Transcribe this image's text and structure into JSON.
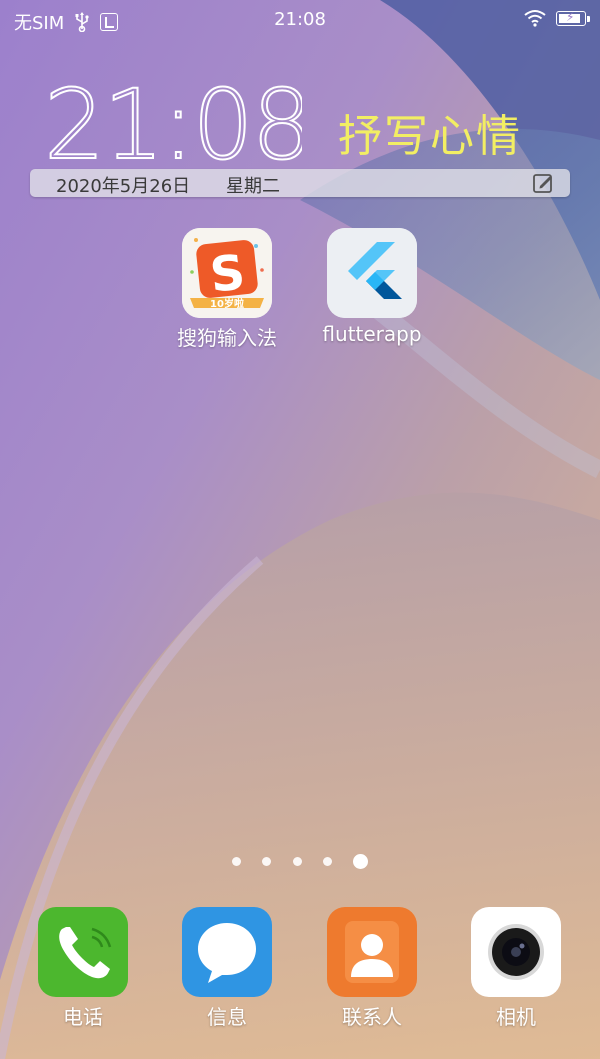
{
  "status_bar": {
    "carrier": "无SIM",
    "time": "21:08",
    "battery_level": 0.9,
    "icons": [
      "usb-icon",
      "usb-debug-icon",
      "wifi-icon",
      "battery-charging-icon"
    ]
  },
  "clock_widget": {
    "big_time": "21:08",
    "mood": "抒写心情",
    "date": "2020年5月26日",
    "weekday": "星期二",
    "edit_icon": "edit-icon"
  },
  "apps": [
    {
      "label": "搜狗输入法",
      "icon": "sogou-icon",
      "badge": "10岁啦"
    },
    {
      "label": "flutterapp",
      "icon": "flutter-icon"
    }
  ],
  "page_indicator": {
    "pages": 5,
    "current": 5
  },
  "dock": [
    {
      "label": "电话",
      "icon": "phone-icon"
    },
    {
      "label": "信息",
      "icon": "message-icon"
    },
    {
      "label": "联系人",
      "icon": "contacts-icon"
    },
    {
      "label": "相机",
      "icon": "camera-icon"
    }
  ],
  "colors": {
    "mood_text": "#f2ee63",
    "phone": "#4cb72e",
    "message": "#2f95e3",
    "contacts": "#ee7a2e",
    "camera": "#ffffff",
    "sogou": "#ee5a28"
  }
}
